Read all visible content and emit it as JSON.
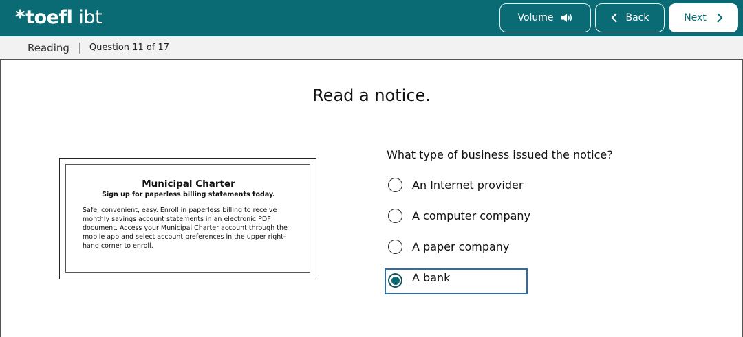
{
  "header": {
    "logo_text": "toefl ibt",
    "logo_main": "toefl",
    "logo_suffix": "ibt",
    "volume_label": "Volume",
    "back_label": "Back",
    "next_label": "Next",
    "accent_color": "#0b6b74"
  },
  "subheader": {
    "section": "Reading",
    "progress": "Question 11 of 17"
  },
  "main": {
    "heading": "Read a notice.",
    "notice": {
      "title": "Municipal Charter",
      "subtitle": "Sign up for paperless billing statements today.",
      "body": "Safe, convenient, easy. Enroll in paperless billing to receive monthly savings account statements in an electronic PDF document. Access your Municipal Charter account through the mobile app and select account preferences in the upper right-hand corner to enroll."
    },
    "question": "What type of business issued the notice?",
    "options": [
      {
        "label": "An Internet provider",
        "selected": false
      },
      {
        "label": "A computer company",
        "selected": false
      },
      {
        "label": "A paper company",
        "selected": false
      },
      {
        "label": "A bank",
        "selected": true
      }
    ]
  },
  "icons": {
    "volume": "speaker-icon",
    "back": "chevron-left-icon",
    "next": "chevron-right-icon",
    "logo": "asterisk-icon"
  }
}
